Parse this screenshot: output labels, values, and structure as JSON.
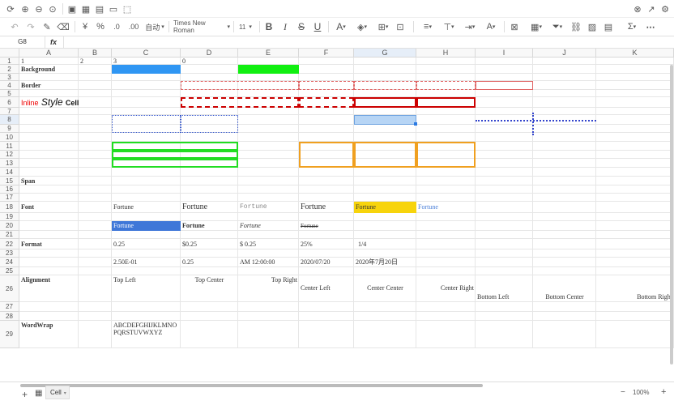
{
  "toolbar": {
    "font_name": "Times New Roman",
    "font_size": "11",
    "number_format": "自动",
    "percent": "%",
    "decimal_down": ".0",
    "decimal_up": ".00"
  },
  "formula_bar": {
    "cell_ref": "G8",
    "fx": "fx",
    "content": ""
  },
  "columns": [
    "A",
    "B",
    "C",
    "D",
    "E",
    "F",
    "G",
    "H",
    "I",
    "J",
    "K"
  ],
  "rows": [
    "1",
    "2",
    "3",
    "4",
    "5",
    "6",
    "7",
    "8",
    "9",
    "10",
    "11",
    "12",
    "13",
    "14",
    "15",
    "16",
    "17",
    "18",
    "19",
    "20",
    "21",
    "22",
    "23",
    "24",
    "25",
    "26",
    "27",
    "28",
    "29"
  ],
  "cells": {
    "a1": "1",
    "b1": "2",
    "c1": "3",
    "d1": "0",
    "a2": "Background",
    "a4": "Border",
    "a6_inline": "Inline",
    "a6_style": "Style",
    "a6_cell": "Cell",
    "a15": "Span",
    "a18": "Font",
    "c18": "Fortune",
    "d18": "Fortune",
    "e18": "Fortune",
    "f18": "Fortune",
    "g18": "Fortune",
    "h18": "Fortune",
    "c20": "Fortune",
    "d20": "Fortune",
    "e20": "Fortune",
    "f20": "Fortune",
    "a22": "Format",
    "c22": "0.25",
    "d22": "$0.25",
    "e22": "$ 0.25",
    "f22": "25%",
    "g22": "1/4",
    "c24": "2.50E-01",
    "d24": "0.25",
    "e24": "AM 12:00:00",
    "f24": "2020/07/20",
    "g24": "2020年7月20日",
    "a26": "Alignment",
    "c26": "Top Left",
    "d26": "Top Center",
    "e26": "Top Right",
    "f26": "Center Left",
    "g26": "Center Center",
    "h26": "Center Right",
    "i26": "Bottom Left",
    "j26": "Bottom Center",
    "k26": "Bottom Right",
    "a29": "WordWrap",
    "c29_1": "ABCDEFGHIJKLMNO",
    "c29_2": "PQRSTUVWXYZ"
  },
  "footer": {
    "sheet_tab": "Cell",
    "zoom": "100%",
    "add": "+",
    "minus": "−"
  },
  "colors": {
    "bg_blue": "#2f96f3",
    "bg_green": "#11ef11",
    "selection": "#b7d5f5",
    "font_highlight": "#f7d40c",
    "font_blue": "#4a7fd8",
    "fill_blue": "#3f77d8"
  }
}
